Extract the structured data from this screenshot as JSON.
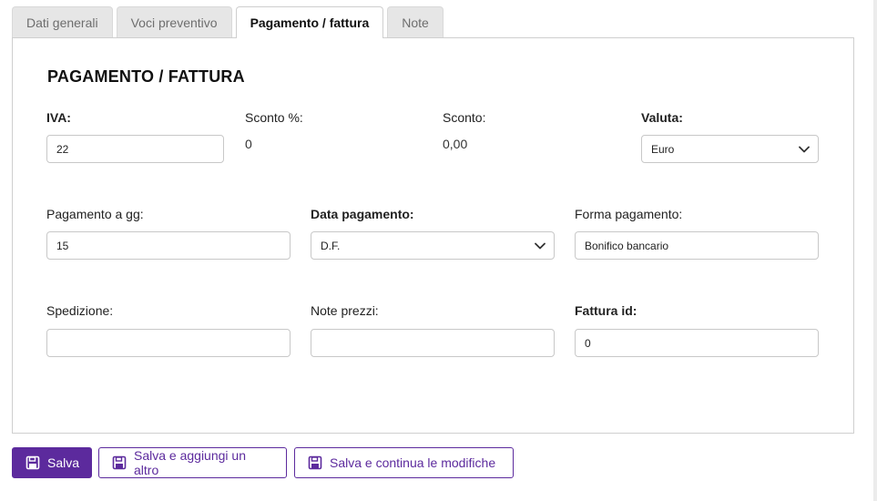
{
  "tabs": [
    {
      "label": "Dati generali",
      "active": false
    },
    {
      "label": "Voci preventivo",
      "active": false
    },
    {
      "label": "Pagamento / fattura",
      "active": true
    },
    {
      "label": "Note",
      "active": false
    }
  ],
  "section": {
    "title": "PAGAMENTO / FATTURA"
  },
  "form": {
    "iva": {
      "label": "IVA:",
      "value": "22"
    },
    "sconto_perc": {
      "label": "Sconto %:",
      "value": "0"
    },
    "sconto": {
      "label": "Sconto:",
      "value": "0,00"
    },
    "valuta": {
      "label": "Valuta:",
      "value": "Euro"
    },
    "pagamento_gg": {
      "label": "Pagamento a gg:",
      "value": "15"
    },
    "data_pagamento": {
      "label": "Data pagamento:",
      "value": "D.F."
    },
    "forma_pagamento": {
      "label": "Forma pagamento:",
      "value": "Bonifico bancario"
    },
    "spedizione": {
      "label": "Spedizione:",
      "value": ""
    },
    "note_prezzi": {
      "label": "Note prezzi:",
      "value": ""
    },
    "fattura_id": {
      "label": "Fattura id:",
      "value": "0"
    }
  },
  "actions": {
    "save": "Salva",
    "save_add": "Salva e aggiungi un altro",
    "save_continue": "Salva e continua le modifiche"
  },
  "colors": {
    "accent": "#5c2a9d",
    "tab_inactive": "#e6e6e6",
    "border": "#cfcfcf"
  },
  "icons": {
    "save": "floppy-disk-icon",
    "dropdown": "chevron-down-icon"
  }
}
